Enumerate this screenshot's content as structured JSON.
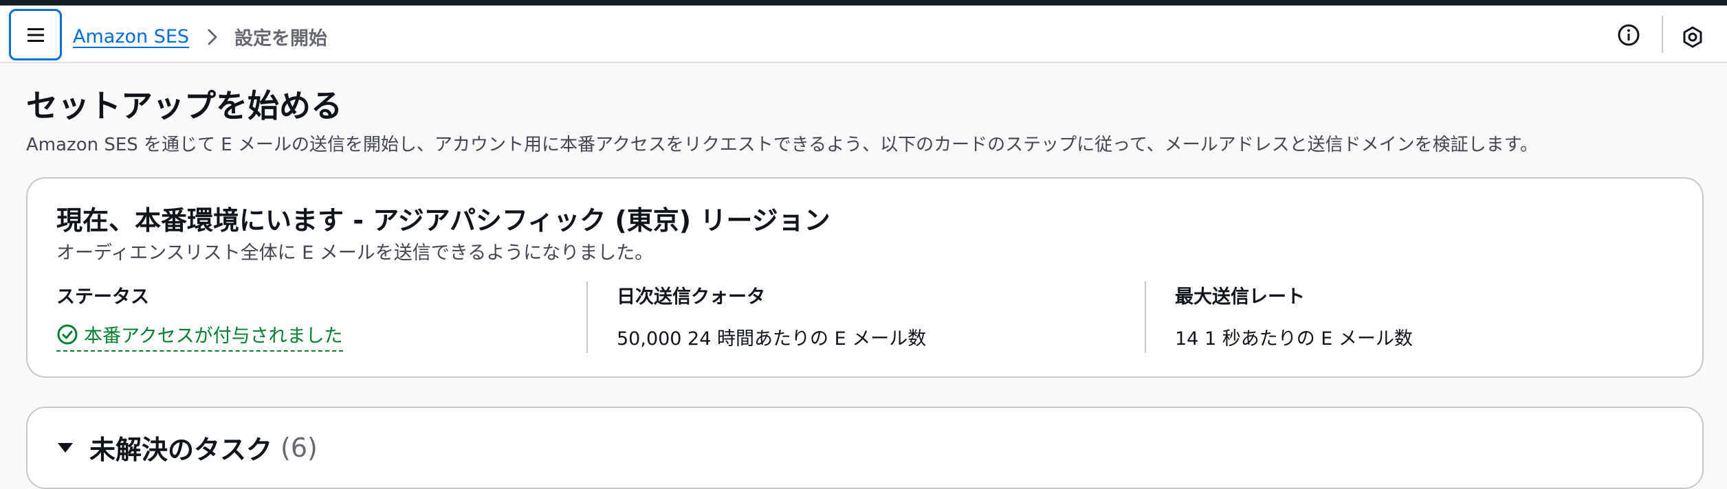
{
  "header": {
    "breadcrumb": {
      "root": "Amazon SES",
      "current": "設定を開始"
    }
  },
  "page": {
    "title": "セットアップを始める",
    "description": "Amazon SES を通じて E メールの送信を開始し、アカウント用に本番アクセスをリクエストできるよう、以下のカードのステップに従って、メールアドレスと送信ドメインを検証します。"
  },
  "account_card": {
    "title": "現在、本番環境にいます - アジアパシフィック (東京) リージョン",
    "subtitle": "オーディエンスリスト全体に E メールを送信できるようになりました。",
    "status_label": "ステータス",
    "status_value": "本番アクセスが付与されました",
    "quota_label": "日次送信クォータ",
    "quota_value": "50,000 24 時間あたりの E メール数",
    "rate_label": "最大送信レート",
    "rate_value": "14 1 秒あたりの E メール数"
  },
  "tasks_card": {
    "title": "未解決のタスク",
    "count": "(6)"
  },
  "colors": {
    "link": "#006ce0",
    "success": "#00802f",
    "border": "#c6c6cd",
    "topbar": "#161d26"
  },
  "icons": [
    "menu-icon",
    "chevron-right-icon",
    "info-icon",
    "hexagon-icon",
    "check-circle-icon",
    "caret-down-icon"
  ]
}
